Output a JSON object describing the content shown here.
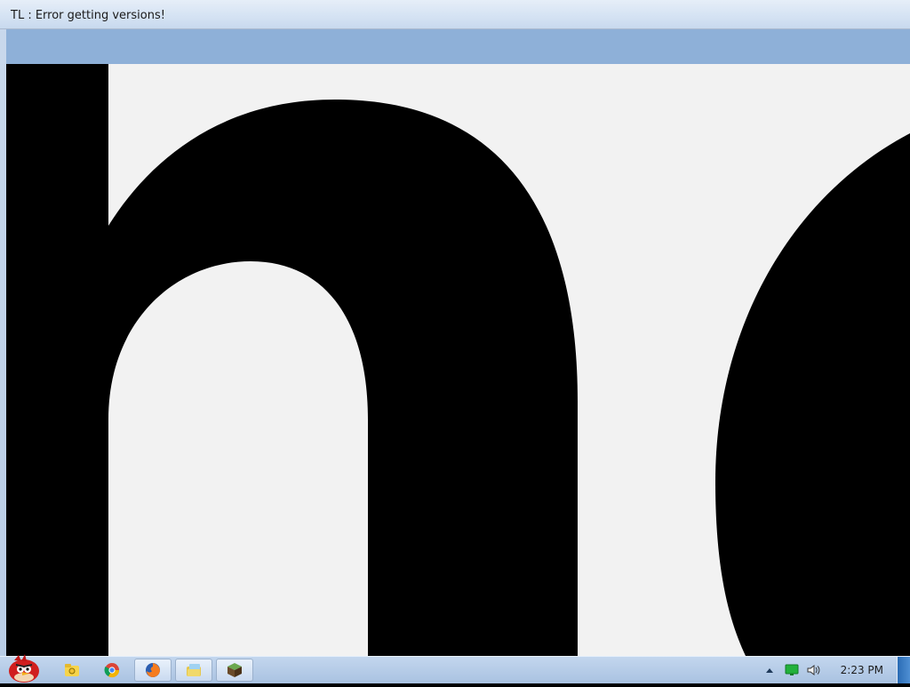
{
  "window": {
    "title": "TL : Error getting versions!",
    "content_text": "no"
  },
  "taskbar": {
    "items": [
      {
        "name": "angry-birds-icon"
      },
      {
        "name": "folder-icon"
      },
      {
        "name": "chrome-icon"
      },
      {
        "name": "firefox-icon"
      },
      {
        "name": "file-manager-icon"
      },
      {
        "name": "minecraft-block-icon"
      }
    ],
    "clock": "2:23 PM"
  }
}
